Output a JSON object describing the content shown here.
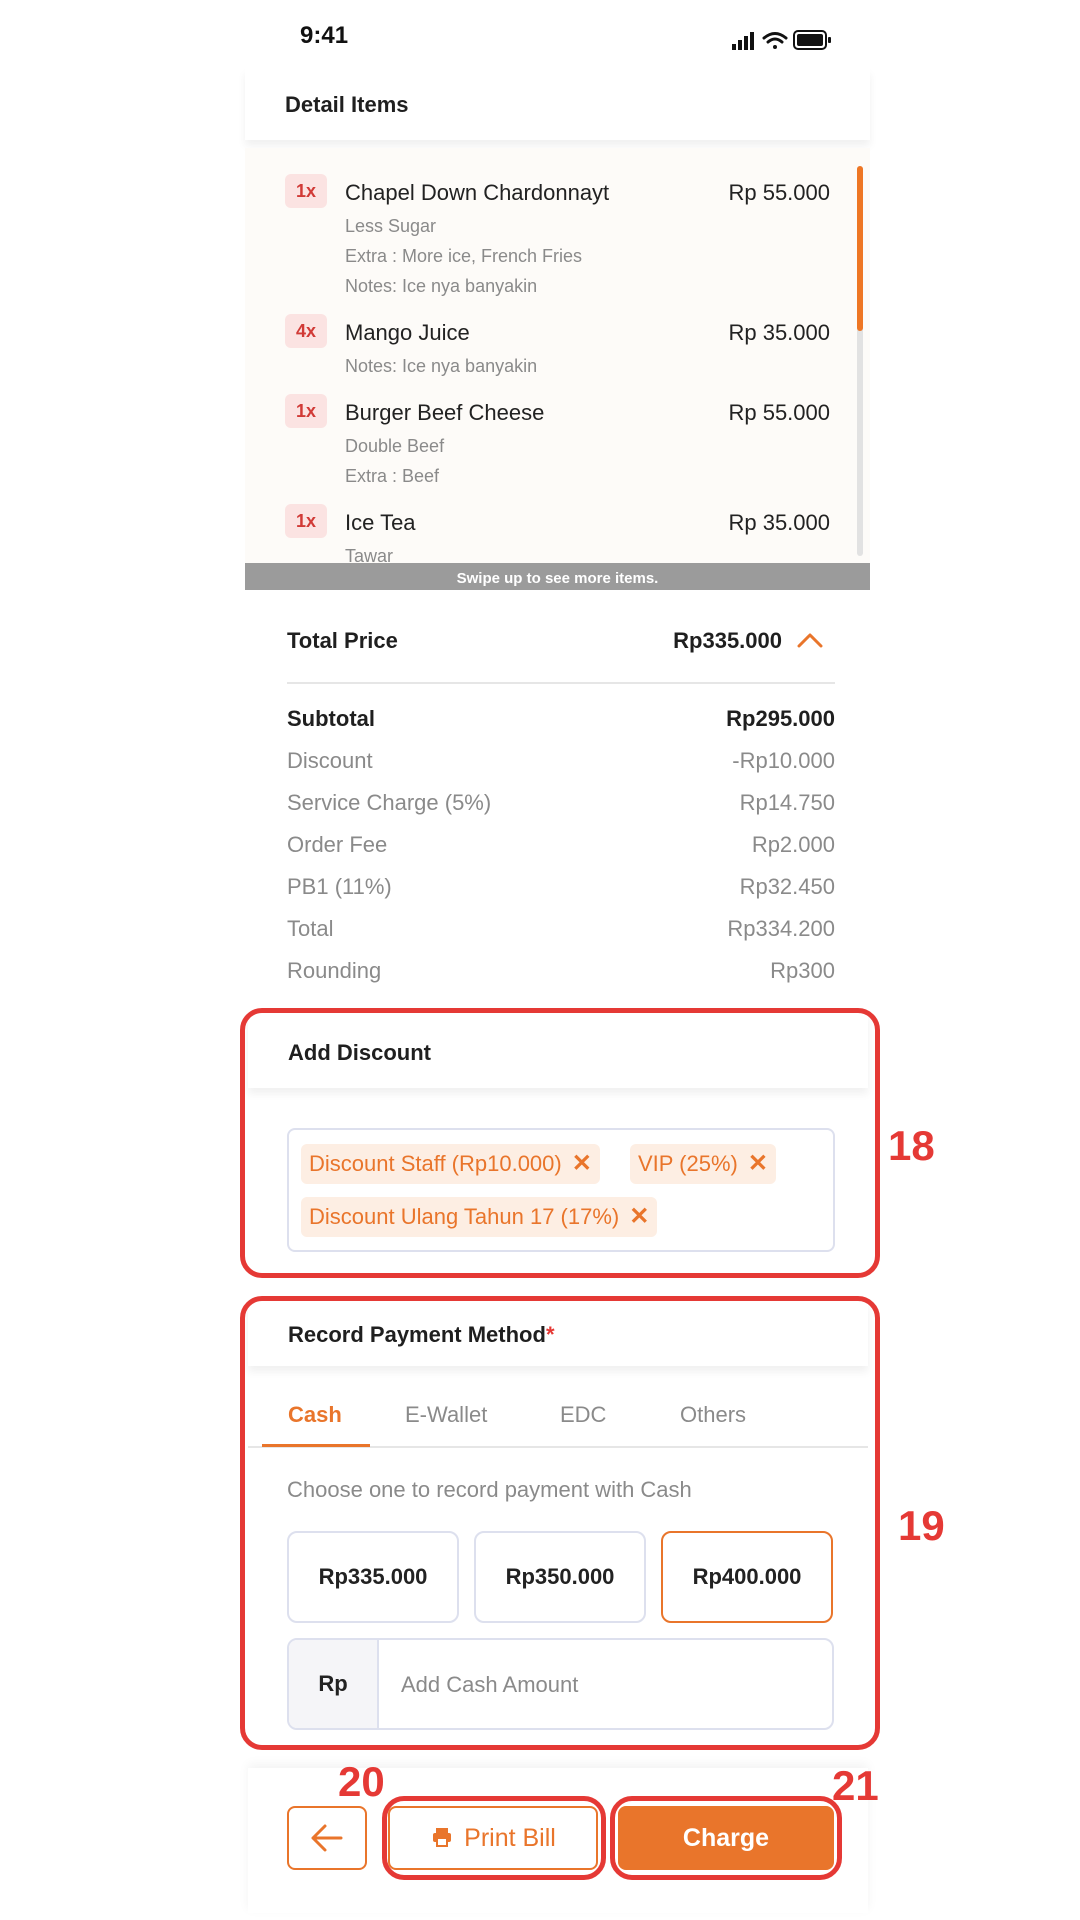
{
  "status_bar": {
    "time": "9:41",
    "icons": [
      "signal-icon",
      "wifi-icon",
      "battery-icon"
    ]
  },
  "detail_items": {
    "title": "Detail Items",
    "swipe_hint": "Swipe up to see more items.",
    "items": [
      {
        "qty": "1x",
        "name": "Chapel Down Chardonnayt",
        "price": "Rp 55.000",
        "notes": [
          "Less Sugar",
          "Extra : More ice, French Fries",
          "Notes: Ice nya banyakin"
        ]
      },
      {
        "qty": "4x",
        "name": "Mango Juice",
        "price": "Rp 35.000",
        "notes": [
          "Notes: Ice nya banyakin"
        ]
      },
      {
        "qty": "1x",
        "name": "Burger Beef Cheese",
        "price": "Rp 55.000",
        "notes": [
          "Double Beef",
          "Extra : Beef"
        ]
      },
      {
        "qty": "1x",
        "name": "Ice Tea",
        "price": "Rp 35.000",
        "notes": [
          "Tawar"
        ]
      }
    ]
  },
  "totals": {
    "total_price_label": "Total Price",
    "total_price_value": "Rp335.000",
    "rows": [
      {
        "label": "Subtotal",
        "value": "Rp295.000"
      },
      {
        "label": "Discount",
        "value": "-Rp10.000"
      },
      {
        "label": "Service Charge (5%)",
        "value": "Rp14.750"
      },
      {
        "label": "Order Fee",
        "value": "Rp2.000"
      },
      {
        "label": "PB1 (11%)",
        "value": "Rp32.450"
      },
      {
        "label": "Total",
        "value": "Rp334.200"
      },
      {
        "label": "Rounding",
        "value": "Rp300"
      }
    ]
  },
  "discount": {
    "title": "Add Discount",
    "chips": [
      "Discount Staff (Rp10.000)",
      "VIP (25%)",
      "Discount Ulang Tahun 17 (17%)"
    ],
    "chip_remove_glyph": "✕"
  },
  "payment": {
    "title": "Record Payment Method",
    "required_mark": "*",
    "tabs": [
      "Cash",
      "E-Wallet",
      "EDC",
      "Others"
    ],
    "active_tab": "Cash",
    "hint": "Choose one to record payment with Cash",
    "amounts": [
      "Rp335.000",
      "Rp350.000",
      "Rp400.000"
    ],
    "selected_amount": "Rp400.000",
    "currency_prefix": "Rp",
    "cash_placeholder": "Add Cash Amount"
  },
  "actions": {
    "back_icon": "arrow-left-icon",
    "print_label": "Print Bill",
    "print_icon": "printer-icon",
    "charge_label": "Charge"
  },
  "annotations": [
    "18",
    "19",
    "20",
    "21"
  ],
  "colors": {
    "accent": "#e9752b",
    "annotation": "#e53935",
    "qty_badge_bg": "#fbe3e2",
    "qty_badge_text": "#d13a36"
  }
}
